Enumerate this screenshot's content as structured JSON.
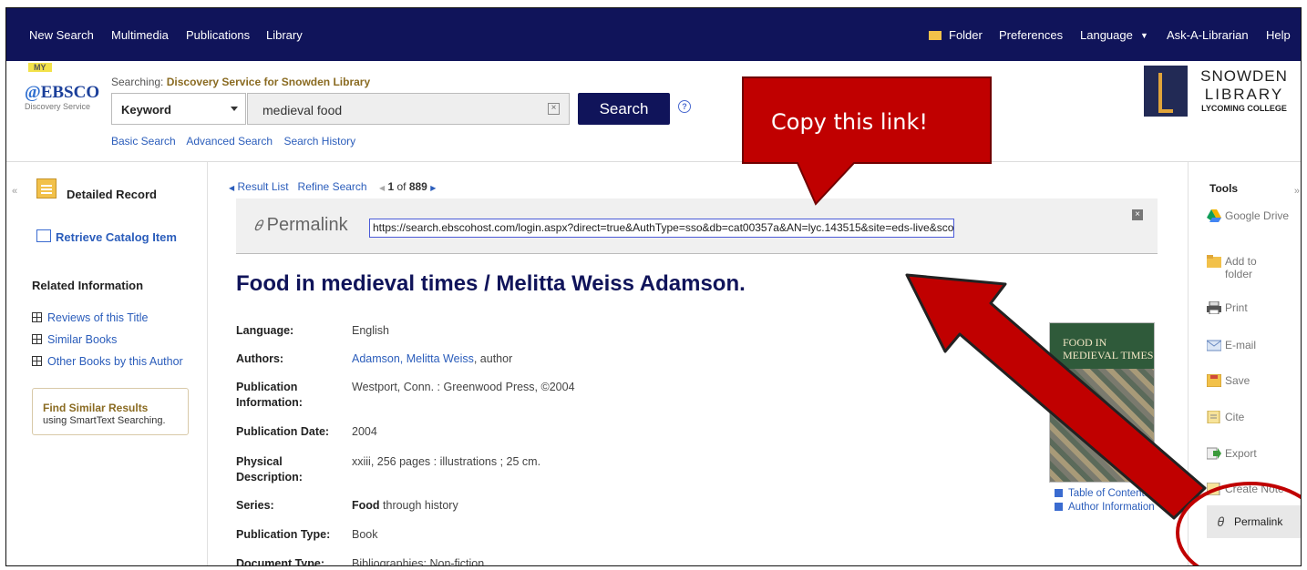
{
  "topnav": {
    "left": [
      "New Search",
      "Multimedia",
      "Publications",
      "Library"
    ],
    "folder": "Folder",
    "preferences": "Preferences",
    "language": "Language",
    "ask": "Ask-A-Librarian",
    "help": "Help"
  },
  "header": {
    "logo_my": "MY",
    "logo_ebsco": "EBSCO",
    "logo_sub": "Discovery Service",
    "searching_prefix": "Searching:",
    "searching_target": "Discovery Service for Snowden Library",
    "field": "Keyword",
    "query": "medieval food",
    "search_label": "Search",
    "sublinks": [
      "Basic Search",
      "Advanced Search",
      "Search History"
    ],
    "library_lines": [
      "SNOWDEN",
      "LIBRARY",
      "LYCOMING COLLEGE"
    ]
  },
  "left": {
    "detailed_record": "Detailed Record",
    "retrieve": "Retrieve Catalog Item",
    "related_head": "Related Information",
    "related_links": [
      "Reviews of this Title",
      "Similar Books",
      "Other Books by this Author"
    ],
    "similar_title": "Find Similar Results",
    "similar_sub": "using SmartText Searching."
  },
  "nav": {
    "result_list": "Result List",
    "refine": "Refine Search",
    "pos": "1",
    "of": "of",
    "total": "889"
  },
  "permalink": {
    "label": "Permalink",
    "url": "https://search.ebscohost.com/login.aspx?direct=true&AuthType=sso&db=cat00357a&AN=lyc.143515&site=eds-live&scope=site"
  },
  "record": {
    "title": "Food in medieval times / Melitta Weiss Adamson.",
    "fields": [
      {
        "label": "Language:",
        "value": "English"
      },
      {
        "label": "Authors:",
        "value": "Adamson, Melitta Weiss",
        "suffix": ", author"
      },
      {
        "label": "Publication Information:",
        "value": "Westport, Conn. : Greenwood Press, ©2004"
      },
      {
        "label": "Publication Date:",
        "value": "2004"
      },
      {
        "label": "Physical Description:",
        "value": "xxiii, 256 pages : illustrations ; 25 cm."
      },
      {
        "label": "Series:",
        "value_bold": "Food",
        "value": " through history"
      },
      {
        "label": "Publication Type:",
        "value": "Book"
      },
      {
        "label": "Document Type:",
        "value": "Bibliographies; Non-fiction"
      }
    ],
    "book_title": "FOOD IN MEDIEVAL TIMES",
    "book_links": [
      "Table of Contents",
      "Author Information"
    ]
  },
  "tools": {
    "head": "Tools",
    "items": [
      {
        "label": "Google Drive",
        "icon": "google-drive-icon"
      },
      {
        "label": "Add to folder",
        "icon": "folder-icon"
      },
      {
        "label": "Print",
        "icon": "printer-icon"
      },
      {
        "label": "E-mail",
        "icon": "email-icon"
      },
      {
        "label": "Save",
        "icon": "save-icon"
      },
      {
        "label": "Cite",
        "icon": "cite-icon"
      },
      {
        "label": "Export",
        "icon": "export-icon"
      },
      {
        "label": "Create Note",
        "icon": "note-icon"
      }
    ],
    "permalink": "Permalink"
  },
  "annotation": {
    "callout": "Copy this link!",
    "color": "#c00000"
  }
}
